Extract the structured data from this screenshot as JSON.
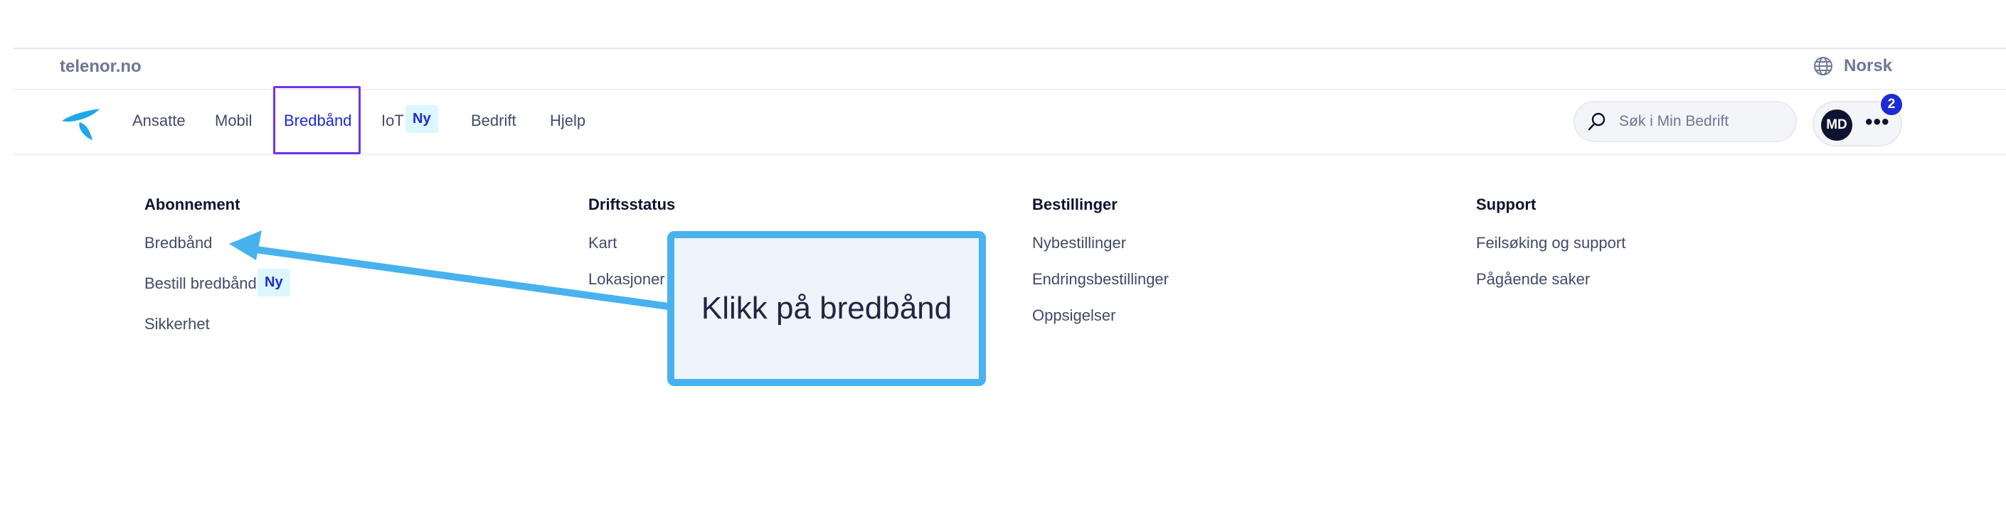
{
  "topbar": {
    "site_link": "telenor.no",
    "language": "Norsk"
  },
  "nav": {
    "items": [
      {
        "label": "Ansatte"
      },
      {
        "label": "Mobil"
      },
      {
        "label": "Bredbånd",
        "active": true
      },
      {
        "label": "IoT",
        "badge": "Ny"
      },
      {
        "label": "Bedrift"
      },
      {
        "label": "Hjelp"
      }
    ],
    "search_placeholder": "Søk i Min Bedrift",
    "user_initials": "MD",
    "notification_count": "2",
    "more_icon": "more-horizontal-icon"
  },
  "mega_menu": {
    "columns": [
      {
        "heading": "Abonnement",
        "links": [
          "Bredbånd",
          "Bestill bredbånd",
          "Sikkerhet"
        ],
        "badge": "Ny"
      },
      {
        "heading": "Driftsstatus",
        "links": [
          "Kart",
          "Lokasjoner"
        ]
      },
      {
        "heading": "Bestillinger",
        "links": [
          "Nybestillinger",
          "Endringsbestillinger",
          "Oppsigelser"
        ]
      },
      {
        "heading": "Support",
        "links": [
          "Feilsøking og support",
          "Pågående saker"
        ]
      }
    ]
  },
  "callout": {
    "text": "Klikk på bredbånd"
  },
  "colors": {
    "accent": "#1b2bd6",
    "active_outline": "#6e36e8",
    "badge_bg": "#dcf7ff",
    "annotation": "#48b2ef",
    "logo": "#1fa7e8"
  }
}
